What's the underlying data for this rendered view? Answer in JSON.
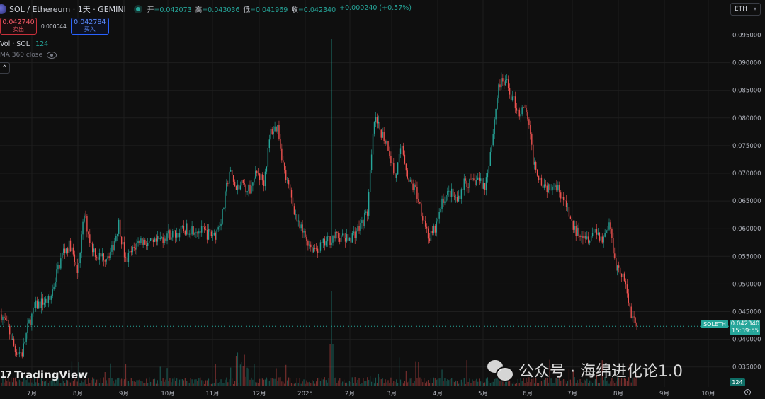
{
  "header": {
    "title": "SOL / Ethereum · 1天 · GEMINI",
    "ohlc": [
      {
        "label": "开",
        "value": "=0.042073"
      },
      {
        "label": "高",
        "value": "=0.043036"
      },
      {
        "label": "低",
        "value": "=0.041969"
      },
      {
        "label": "收",
        "value": "=0.042340"
      }
    ],
    "change": "+0.000240 (+0.57%)"
  },
  "trade": {
    "sell_price": "0.042740",
    "sell_label": "卖出",
    "spread": "0.000044",
    "buy_price": "0.042784",
    "buy_label": "买入"
  },
  "indicators": {
    "volume_label": "Vol · SOL",
    "volume_value": "124",
    "ma_label": "MA 360 close"
  },
  "currency": "ETH",
  "last_price": {
    "symbol": "SOLETH",
    "price": "0.042340",
    "countdown": "15:39:55"
  },
  "volume_badge": "124",
  "logo_text": "TradingView",
  "watermark": "公众号 · 海绵进化论1.0",
  "colors": {
    "up": "#26a69a",
    "down": "#ef5350",
    "background": "#0f0f0f",
    "grid": "#1e1e1e"
  },
  "chart_data": {
    "type": "candlestick",
    "interval": "1D",
    "symbol": "SOLETH",
    "exchange": "GEMINI",
    "y_axis": {
      "side": "right",
      "ticks": [
        "0.095000",
        "0.090000",
        "0.085000",
        "0.080000",
        "0.075000",
        "0.070000",
        "0.065000",
        "0.060000",
        "0.055000",
        "0.050000",
        "0.045000",
        "0.040000",
        "0.035000"
      ],
      "ylim": [
        0.0325,
        0.0975
      ]
    },
    "x_axis": {
      "ticks": [
        "7月",
        "8月",
        "9月",
        "10月",
        "11月",
        "12月",
        "2025",
        "2月",
        "3月",
        "4月",
        "5月",
        "6月",
        "7月",
        "8月",
        "9月",
        "10月"
      ]
    },
    "series_approx": {
      "t": [
        0,
        5,
        10,
        15,
        20,
        25,
        30,
        35,
        40,
        45,
        50,
        55,
        60,
        65,
        70,
        75,
        80,
        85,
        90,
        95,
        100,
        105,
        110,
        115,
        120,
        125,
        130,
        135,
        140,
        145,
        150,
        155,
        160,
        165,
        170,
        175,
        180,
        185,
        190,
        195,
        200,
        205,
        210,
        215,
        220,
        225,
        230,
        235,
        240,
        245,
        250,
        255,
        260,
        265,
        270,
        275,
        280,
        285,
        290,
        295,
        300,
        305,
        310,
        315,
        320,
        325,
        330,
        335,
        340,
        345,
        350,
        355,
        360,
        365,
        370,
        375,
        380,
        385,
        390,
        395,
        400,
        405,
        410,
        415,
        420,
        425,
        430,
        435,
        440,
        445,
        450,
        455,
        460
      ],
      "close": [
        0.0445,
        0.042,
        0.038,
        0.0375,
        0.043,
        0.046,
        0.0468,
        0.047,
        0.052,
        0.056,
        0.057,
        0.052,
        0.0625,
        0.057,
        0.055,
        0.055,
        0.056,
        0.061,
        0.054,
        0.056,
        0.058,
        0.0575,
        0.057,
        0.058,
        0.059,
        0.059,
        0.0595,
        0.06,
        0.06,
        0.0595,
        0.059,
        0.059,
        0.0625,
        0.0705,
        0.067,
        0.068,
        0.067,
        0.07,
        0.0685,
        0.0775,
        0.0785,
        0.07,
        0.0655,
        0.0605,
        0.0585,
        0.0565,
        0.0565,
        0.0575,
        0.0585,
        0.0585,
        0.058,
        0.059,
        0.0605,
        0.063,
        0.0795,
        0.0775,
        0.075,
        0.069,
        0.075,
        0.0685,
        0.067,
        0.0625,
        0.058,
        0.0605,
        0.0655,
        0.0665,
        0.065,
        0.0685,
        0.068,
        0.069,
        0.0675,
        0.0755,
        0.086,
        0.0865,
        0.0835,
        0.081,
        0.0815,
        0.0725,
        0.069,
        0.0675,
        0.0685,
        0.0665,
        0.063,
        0.0595,
        0.0595,
        0.0585,
        0.06,
        0.058,
        0.061,
        0.0535,
        0.0515,
        0.0455,
        0.0423
      ]
    },
    "last_close": 0.04234,
    "marked_high": 0.0943,
    "marked_low": 0.0369
  }
}
